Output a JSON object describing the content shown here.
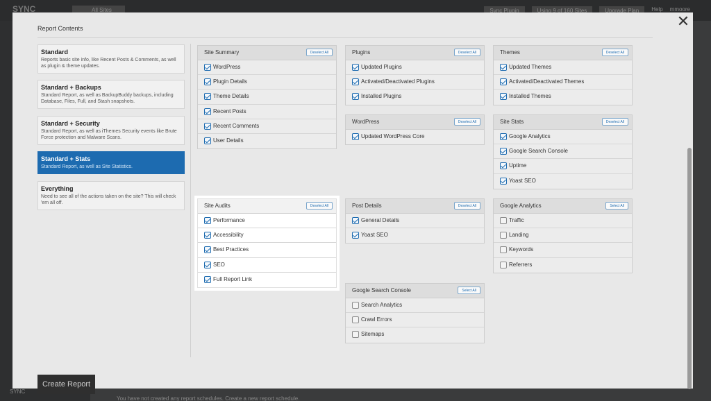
{
  "background": {
    "logo_text": "SYNC",
    "all_sites_tab": "All Sites",
    "top_right": [
      "Sync Plugin",
      "Using 9 of 160 Sites",
      "Upgrade Plan",
      "Help",
      "mmoore"
    ],
    "sidebar_bottom": "SYNC",
    "footer_message": "You have not created any report schedules. Create a new report schedule."
  },
  "modal": {
    "title": "Report Contents",
    "close_glyph": "✕",
    "create_button": "Create Report"
  },
  "report_options": [
    {
      "title": "Standard",
      "desc": "Reports basic site info, like Recent Posts & Comments, as well as plugin & theme updates.",
      "active": false
    },
    {
      "title": "Standard + Backups",
      "desc": "Standard Report, as well as BackupBuddy backups, including Database, Files, Full, and Stash snapshots.",
      "active": false
    },
    {
      "title": "Standard + Security",
      "desc": "Standard Report, as well as iThemes Security events like Brute Force protection and Malware Scans.",
      "active": false
    },
    {
      "title": "Standard + Stats",
      "desc": "Standard Report, as well as Site Statistics.",
      "active": true
    },
    {
      "title": "Everything",
      "desc": "Need to see all of the actions taken on the site? This will check 'em all off.",
      "active": false
    }
  ],
  "panels": [
    {
      "title": "Site Summary",
      "button": "Deselect All",
      "items": [
        {
          "label": "WordPress",
          "checked": true
        },
        {
          "label": "Plugin Details",
          "checked": true
        },
        {
          "label": "Theme Details",
          "checked": true
        },
        {
          "label": "Recent Posts",
          "checked": true
        },
        {
          "label": "Recent Comments",
          "checked": true
        },
        {
          "label": "User Details",
          "checked": true
        }
      ]
    },
    {
      "title": "Site Audits",
      "button": "Deselect All",
      "items": [
        {
          "label": "Performance",
          "checked": true
        },
        {
          "label": "Accessibility",
          "checked": true
        },
        {
          "label": "Best Practices",
          "checked": true
        },
        {
          "label": "SEO",
          "checked": true
        },
        {
          "label": "Full Report Link",
          "checked": true
        }
      ]
    },
    {
      "title": "Plugins",
      "button": "Deselect All",
      "items": [
        {
          "label": "Updated Plugins",
          "checked": true
        },
        {
          "label": "Activated/Deactivated Plugins",
          "checked": true
        },
        {
          "label": "Installed Plugins",
          "checked": true
        }
      ]
    },
    {
      "title": "WordPress",
      "button": "Deselect All",
      "items": [
        {
          "label": "Updated WordPress Core",
          "checked": true
        }
      ]
    },
    {
      "title": "Post Details",
      "button": "Deselect All",
      "items": [
        {
          "label": "General Details",
          "checked": true
        },
        {
          "label": "Yoast SEO",
          "checked": true
        }
      ]
    },
    {
      "title": "Google Search Console",
      "button": "Select All",
      "items": [
        {
          "label": "Search Analytics",
          "checked": false
        },
        {
          "label": "Crawl Errors",
          "checked": false
        },
        {
          "label": "Sitemaps",
          "checked": false
        }
      ]
    },
    {
      "title": "Themes",
      "button": "Deselect All",
      "items": [
        {
          "label": "Updated Themes",
          "checked": true
        },
        {
          "label": "Activated/Deactivated Themes",
          "checked": true
        },
        {
          "label": "Installed Themes",
          "checked": true
        }
      ]
    },
    {
      "title": "Site Stats",
      "button": "Deselect All",
      "items": [
        {
          "label": "Google Analytics",
          "checked": true
        },
        {
          "label": "Google Search Console",
          "checked": true
        },
        {
          "label": "Uptime",
          "checked": true
        },
        {
          "label": "Yoast SEO",
          "checked": true
        }
      ]
    },
    {
      "title": "Google Analytics",
      "button": "Select All",
      "items": [
        {
          "label": "Traffic",
          "checked": false
        },
        {
          "label": "Landing",
          "checked": false
        },
        {
          "label": "Keywords",
          "checked": false
        },
        {
          "label": "Referrers",
          "checked": false
        }
      ]
    }
  ]
}
